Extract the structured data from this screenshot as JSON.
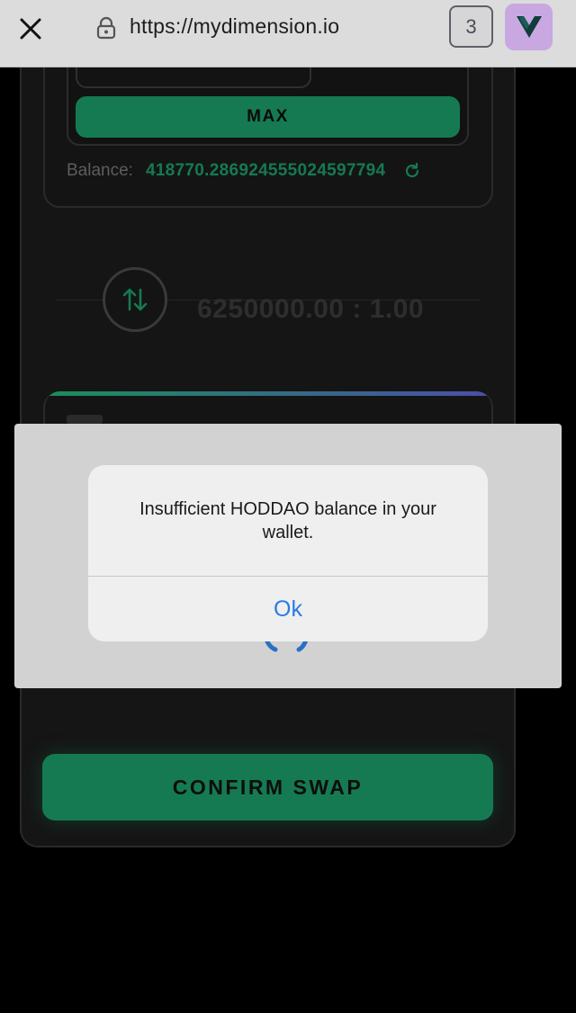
{
  "browser": {
    "url": "https://mydimension.io",
    "tab_count": "3",
    "icons": {
      "close": "close-icon",
      "lock": "lock-icon",
      "extension": "dimension-extension-icon"
    }
  },
  "swap": {
    "max_label": "MAX",
    "balance_label": "Balance:",
    "balance_value": "418770.286924555024597794",
    "rate": "6250000.00 : 1.00",
    "confirm_label": "CONFIRM SWAP"
  },
  "alert": {
    "message": "Insufficient HODDAO balance in your wallet.",
    "ok_label": "Ok"
  },
  "colors": {
    "accent_green": "#157a52",
    "alert_link_blue": "#2a7be0",
    "extension_bg": "#c9a8e2"
  }
}
